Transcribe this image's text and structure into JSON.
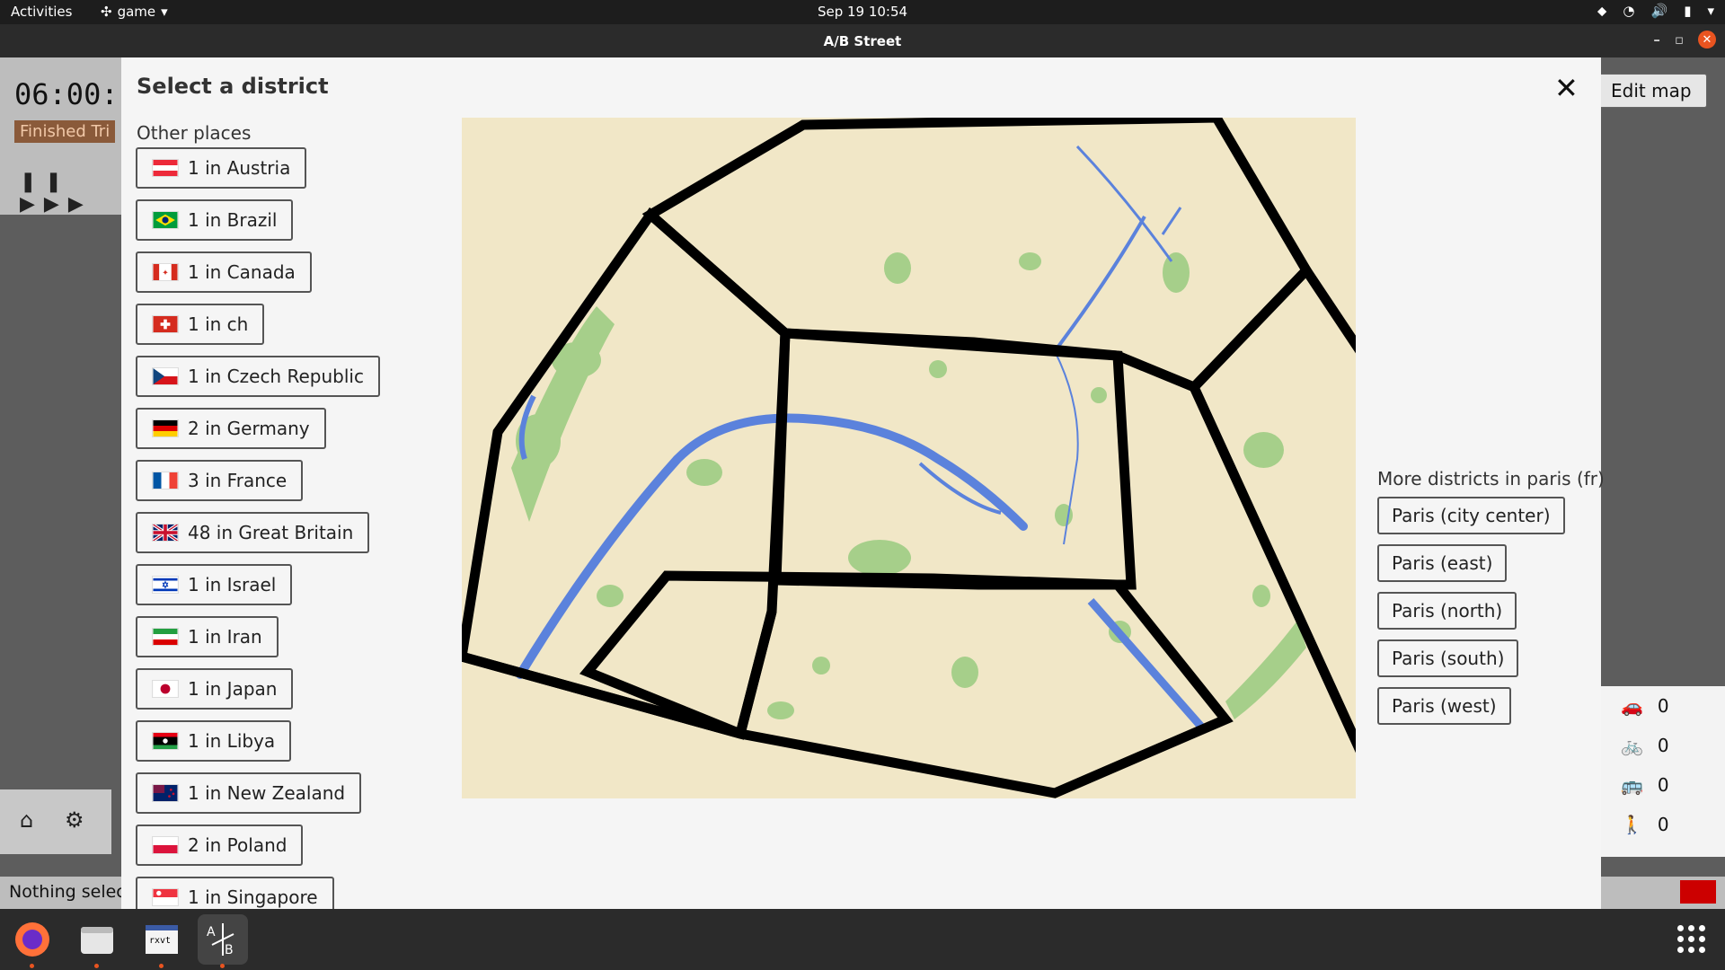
{
  "topbar": {
    "activities": "Activities",
    "app_menu": "game",
    "clock": "Sep 19  10:54"
  },
  "window": {
    "title": "A/B Street"
  },
  "background": {
    "time": "06:00:",
    "finished": "Finished Tri",
    "edit_map": "Edit map",
    "status": "Nothing selec",
    "counts": [
      {
        "icon": "car-icon",
        "glyph": "🚗",
        "value": "0"
      },
      {
        "icon": "bike-icon",
        "glyph": "🚲",
        "value": "0"
      },
      {
        "icon": "bus-icon",
        "glyph": "🚌",
        "value": "0"
      },
      {
        "icon": "pedestrian-icon",
        "glyph": "🚶",
        "value": "0"
      }
    ]
  },
  "modal": {
    "title": "Select a district",
    "close_glyph": "✕",
    "other_places_label": "Other places",
    "countries": [
      {
        "label": "1 in Austria",
        "flag": "austria"
      },
      {
        "label": "1 in Brazil",
        "flag": "brazil"
      },
      {
        "label": "1 in Canada",
        "flag": "canada"
      },
      {
        "label": "1 in ch",
        "flag": "switzerland"
      },
      {
        "label": "1 in Czech Republic",
        "flag": "czech"
      },
      {
        "label": "2 in Germany",
        "flag": "germany"
      },
      {
        "label": "3 in France",
        "flag": "france"
      },
      {
        "label": "48 in Great Britain",
        "flag": "uk"
      },
      {
        "label": "1 in Israel",
        "flag": "israel"
      },
      {
        "label": "1 in Iran",
        "flag": "iran"
      },
      {
        "label": "1 in Japan",
        "flag": "japan"
      },
      {
        "label": "1 in Libya",
        "flag": "libya"
      },
      {
        "label": "1 in New Zealand",
        "flag": "nz"
      },
      {
        "label": "2 in Poland",
        "flag": "poland"
      },
      {
        "label": "1 in Singapore",
        "flag": "singapore"
      }
    ],
    "more_districts_label": "More districts in paris (fr)",
    "districts": [
      "Paris (city center)",
      "Paris (east)",
      "Paris (north)",
      "Paris (south)",
      "Paris (west)"
    ]
  },
  "colors": {
    "map_land": "#f1e7c7",
    "water": "#5b82dc",
    "park": "#a6cf8a",
    "boundary": "#000000",
    "accent": "#e95420"
  },
  "dock": {
    "items": [
      "firefox-icon",
      "files-icon",
      "terminal-icon",
      "abstreet-icon"
    ]
  }
}
